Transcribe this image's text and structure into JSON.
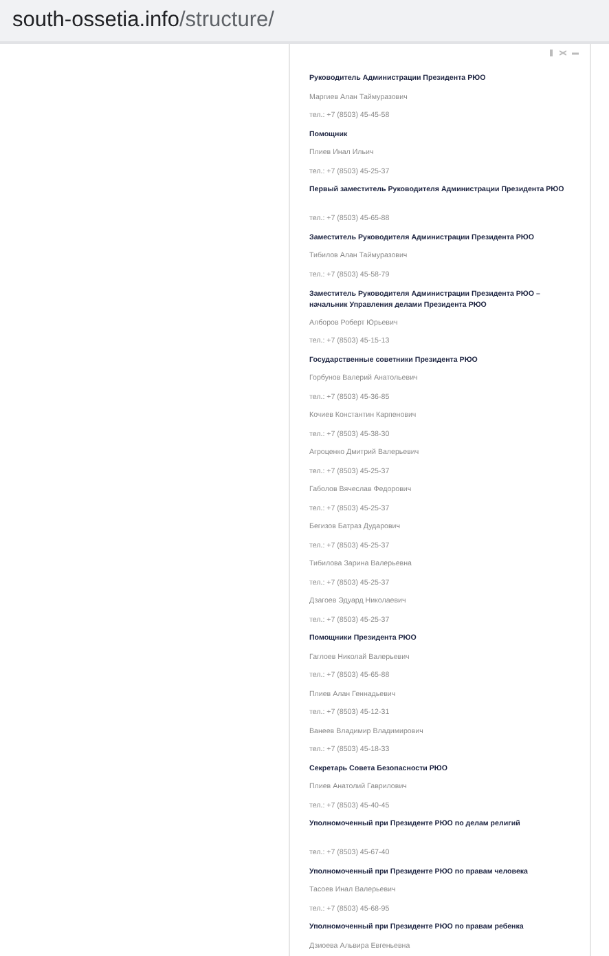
{
  "address_bar": {
    "domain": "south-ossetia.info",
    "path": "/structure/"
  },
  "groups": [
    {
      "title": "Руководитель Администрации Президента РЮО",
      "people": [
        {
          "name": "Маргиев Алан Таймуразович",
          "phone": "тел.: +7 (8503) 45-45-58"
        }
      ]
    },
    {
      "title": "Помощник",
      "people": [
        {
          "name": "Плиев Инал Ильич",
          "phone": "тел.: +7 (8503) 45-25-37"
        }
      ]
    },
    {
      "title": "Первый заместитель Руководителя Администрации Президента РЮО",
      "people": [
        {
          "phone": "тел.: +7 (8503) 45-65-88"
        }
      ]
    },
    {
      "title": "Заместитель Руководителя Администрации Президента РЮО",
      "people": [
        {
          "name": "Тибилов Алан Таймуразович",
          "phone": "тел.: +7 (8503) 45-58-79"
        }
      ]
    },
    {
      "title": "Заместитель Руководителя Администрации Президента РЮО – начальник Управления делами Президента РЮО",
      "people": [
        {
          "name": "Алборов Роберт Юрьевич",
          "phone": "тел.: +7 (8503) 45-15-13"
        }
      ]
    },
    {
      "title": "Государственные советники Президента РЮО",
      "people": [
        {
          "name": "Горбунов Валерий Анатольевич",
          "phone": "тел.: +7 (8503) 45-36-85"
        },
        {
          "name": "Кочиев Константин Карпенович",
          "phone": "тел.: +7 (8503) 45-38-30"
        },
        {
          "name": "Агроценко Дмитрий Валерьевич",
          "phone": "тел.: +7 (8503) 45-25-37"
        },
        {
          "name": "Габолов Вячеслав Федорович",
          "phone": "тел.: +7 (8503) 45-25-37"
        },
        {
          "name": "Бегизов Батраз Дударович",
          "phone": "тел.: +7 (8503) 45-25-37"
        },
        {
          "name": "Тибилова Зарина Валерьевна",
          "phone": "тел.: +7 (8503) 45-25-37"
        },
        {
          "name": "Дзагоев Эдуард Николаевич",
          "phone": "тел.: +7 (8503) 45-25-37"
        }
      ]
    },
    {
      "title": "Помощники Президента РЮО",
      "people": [
        {
          "name": "Гаглоев Николай Валерьевич",
          "phone": "тел.: +7 (8503) 45-65-88"
        },
        {
          "name": "Плиев Алан Геннадьевич",
          "phone": "тел.: +7 (8503) 45-12-31"
        },
        {
          "name": "Ванеев Владимир Владимирович",
          "phone": "тел.: +7 (8503) 45-18-33"
        }
      ]
    },
    {
      "title": "Секретарь Совета Безопасности РЮО",
      "people": [
        {
          "name": "Плиев Анатолий Гаврилович",
          "phone": "тел.: +7 (8503) 45-40-45"
        }
      ]
    },
    {
      "title": "Уполномоченный при Президенте РЮО по делам религий",
      "people": [
        {
          "phone": "тел.: +7 (8503) 45-67-40"
        }
      ]
    },
    {
      "title": "Уполномоченный при Президенте РЮО по правам человека",
      "people": [
        {
          "name": "Тасоев Инал Валерьевич",
          "phone": "тел.: +7 (8503) 45-68-95"
        }
      ]
    },
    {
      "title": "Уполномоченный при Президенте РЮО по правам ребенка",
      "people": [
        {
          "name": "Дзиоева Альвира Евгеньевна"
        }
      ]
    }
  ]
}
